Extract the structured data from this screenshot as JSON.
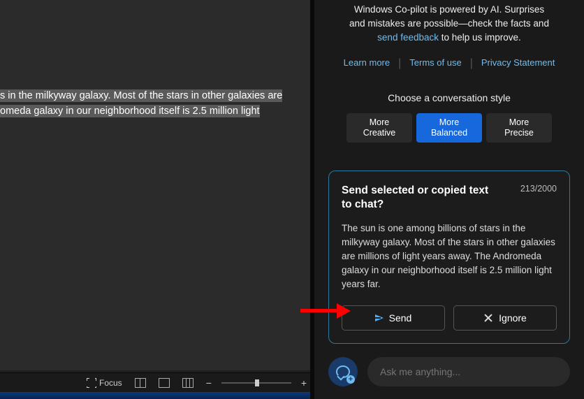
{
  "document": {
    "selected_line1": "s in the milkyway galaxy. Most of the stars in other galaxies are ",
    "selected_line2": "omeda galaxy in our neighborhood itself is 2.5 million light "
  },
  "statusbar": {
    "focus": "Focus"
  },
  "copilot": {
    "notice_line1": "Windows Co-pilot is powered by AI. Surprises",
    "notice_line2": "and mistakes are possible—check the facts and",
    "notice_link": "send feedback",
    "notice_tail": " to help us improve.",
    "learn_more": "Learn more",
    "terms": "Terms of use",
    "privacy": "Privacy Statement",
    "style_heading": "Choose a conversation style",
    "styles": {
      "creative_top": "More",
      "creative_bot": "Creative",
      "balanced_top": "More",
      "balanced_bot": "Balanced",
      "precise_top": "More",
      "precise_bot": "Precise"
    },
    "card": {
      "title": "Send selected or copied text to chat?",
      "count": "213/2000",
      "body": "The sun is one among billions of stars in the milkyway galaxy. Most of the stars in other galaxies are millions of light years away. The Andromeda galaxy in our neighborhood itself is 2.5 million light years far.",
      "send": "Send",
      "ignore": "Ignore"
    },
    "ask_placeholder": "Ask me anything..."
  }
}
